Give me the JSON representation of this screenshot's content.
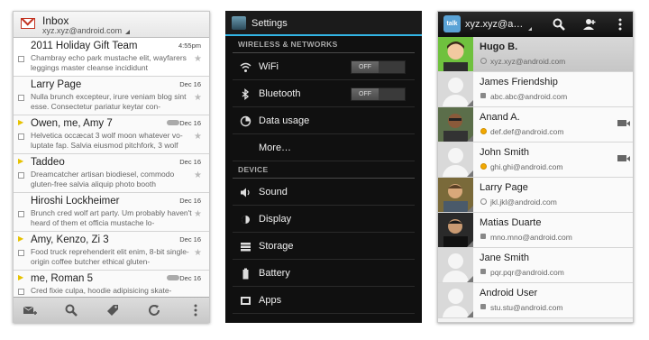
{
  "gmail": {
    "title": "Inbox",
    "account": "xyz.xyz@android.com",
    "messages": [
      {
        "from": "2011 Holiday Gift Team",
        "date": "4:55pm",
        "snippet": "Chambray echo park mustache elit, wayfarers leggings master cleanse incididunt"
      },
      {
        "from": "Larry Page",
        "date": "Dec 16",
        "snippet": "Nulla brunch excepteur, irure veniam blog sint esse. Consectetur pariatur keytar con-"
      },
      {
        "from": "Owen, me, Amy  7",
        "date": "Dec 16",
        "snippet": "Helvetica occæcat 3 wolf moon whatever vo-luptate fap. Salvia eiusmod pitchfork, 3 wolf"
      },
      {
        "from": "Taddeo",
        "date": "Dec 16",
        "snippet": "Dreamcatcher artisan biodiesel, commodo gluten-free salvia aliquip photo booth"
      },
      {
        "from": "Hiroshi Lockheimer",
        "date": "Dec 16",
        "snippet": "Brunch cred wolf art party. Um probably haven't heard of them et officia mustache lo-"
      },
      {
        "from": "Amy, Kenzo, Zi  3",
        "date": "Dec 16",
        "snippet": "Food truck reprehenderit elit enim, 8-bit single-origin coffee butcher ethical gluten-"
      },
      {
        "from": "me, Roman  5",
        "date": "Dec 16",
        "snippet": "Cred fixie culpa, hoodie adipisicing skate-"
      }
    ]
  },
  "settings": {
    "title": "Settings",
    "section_wireless": "WIRELESS & NETWORKS",
    "wifi": "WiFi",
    "wifi_state": "OFF",
    "bluetooth": "Bluetooth",
    "bluetooth_state": "OFF",
    "data_usage": "Data usage",
    "more": "More…",
    "section_device": "DEVICE",
    "sound": "Sound",
    "display": "Display",
    "storage": "Storage",
    "battery": "Battery",
    "apps": "Apps"
  },
  "people": {
    "talk_label": "talk",
    "account": "xyz.xyz@a…",
    "contacts": [
      {
        "name": "Hugo B.",
        "email": "xyz.xyz@android.com"
      },
      {
        "name": "James Friendship",
        "email": "abc.abc@android.com"
      },
      {
        "name": "Anand A.",
        "email": "def.def@android.com"
      },
      {
        "name": "John Smith",
        "email": "ghi.ghi@android.com"
      },
      {
        "name": "Larry Page",
        "email": "jkl.jkl@android.com"
      },
      {
        "name": "Matias Duarte",
        "email": "mno.mno@android.com"
      },
      {
        "name": "Jane Smith",
        "email": "pqr.pqr@android.com"
      },
      {
        "name": "Android User",
        "email": "stu.stu@android.com"
      }
    ]
  }
}
